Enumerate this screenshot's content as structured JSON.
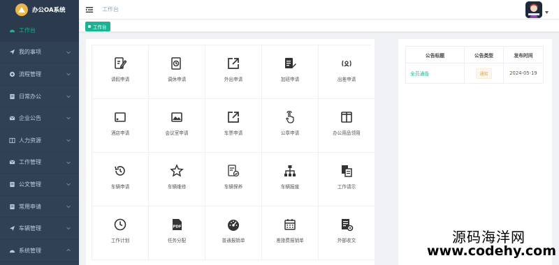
{
  "app": {
    "title": "办公OA系统"
  },
  "header": {
    "breadcrumb": "工作台"
  },
  "tagsbar": {
    "active_tag": "工作台"
  },
  "sidebar": {
    "items": [
      {
        "label": "工作台",
        "icon": "dashboard-icon",
        "active": true
      },
      {
        "label": "我的事项",
        "icon": "paper-plane-icon"
      },
      {
        "label": "流程管理",
        "icon": "flow-icon"
      },
      {
        "label": "日常办公",
        "icon": "document-icon"
      },
      {
        "label": "企业公告",
        "icon": "mail-icon"
      },
      {
        "label": "人力资源",
        "icon": "book-icon"
      },
      {
        "label": "工作管理",
        "icon": "mail-icon"
      },
      {
        "label": "公文管理",
        "icon": "document-icon"
      },
      {
        "label": "常用申请",
        "icon": "document-icon"
      },
      {
        "label": "车辆管理",
        "icon": "paper-plane-icon"
      },
      {
        "label": "系统管理",
        "icon": "dashboard-icon"
      }
    ]
  },
  "apps": [
    {
      "label": "请假申请",
      "icon": "edit-note-icon"
    },
    {
      "label": "调休申请",
      "icon": "clock-document-icon"
    },
    {
      "label": "外出申请",
      "icon": "external-link-icon"
    },
    {
      "label": "加班申请",
      "icon": "document-pen-icon"
    },
    {
      "label": "出差申请",
      "icon": "person-signal-icon"
    },
    {
      "label": "酒店申请",
      "icon": "tablet-icon"
    },
    {
      "label": "会议室申请",
      "icon": "image-icon"
    },
    {
      "label": "车票申请",
      "icon": "external-link-icon"
    },
    {
      "label": "公章申请",
      "icon": "hand-pointer-icon"
    },
    {
      "label": "办公用品领用",
      "icon": "columns-icon"
    },
    {
      "label": "车辆申请",
      "icon": "history-icon"
    },
    {
      "label": "车辆维修",
      "icon": "star-icon"
    },
    {
      "label": "车辆保养",
      "icon": "document-check-icon"
    },
    {
      "label": "车辆报废",
      "icon": "org-chart-icon"
    },
    {
      "label": "工作请示",
      "icon": "copy-icon"
    },
    {
      "label": "工作计划",
      "icon": "clock-icon"
    },
    {
      "label": "任务分配",
      "icon": "pdf-icon"
    },
    {
      "label": "普通报销单",
      "icon": "gauge-icon"
    },
    {
      "label": "差旅费报销单",
      "icon": "calendar-icon"
    },
    {
      "label": "外部收文",
      "icon": "doc-gear-icon"
    }
  ],
  "notices": {
    "headers": [
      "公告标题",
      "公告类型",
      "发布时间"
    ],
    "rows": [
      {
        "title": "全员通告",
        "type": "通知",
        "date": "2024-05-19"
      }
    ]
  },
  "watermark": {
    "line1": "源码海洋网",
    "line2": "www.codehy.com"
  },
  "colors": {
    "accent": "#1ab394",
    "sidebar_bg": "#304156",
    "tag_bg": "#1ab394",
    "notice_tag": "#e6a23c"
  }
}
